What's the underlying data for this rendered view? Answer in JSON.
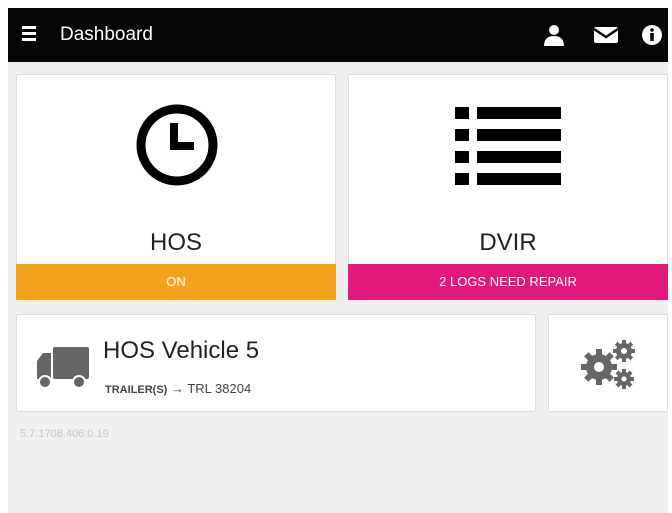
{
  "topbar": {
    "title": "Dashboard",
    "menu_icon": "hamburger-menu-icon",
    "user_icon": "user-icon",
    "mail_icon": "envelope-icon",
    "info_icon": "info-icon"
  },
  "tiles": {
    "hos": {
      "label": "HOS",
      "status": "ON",
      "status_color": "#f3a21c",
      "icon": "clock-icon"
    },
    "dvir": {
      "label": "DVIR",
      "status": "2 LOGS NEED REPAIR",
      "status_color": "#e2197b",
      "icon": "list-icon"
    }
  },
  "vehicle": {
    "name": "HOS Vehicle 5",
    "trailer_label": "TRAILER(S)",
    "trailer_arrow": "→",
    "trailer_value": "TRL 38204",
    "icon": "truck-icon"
  },
  "settings": {
    "icon": "gears-icon"
  },
  "version": "5.7.1708.406:0.19"
}
